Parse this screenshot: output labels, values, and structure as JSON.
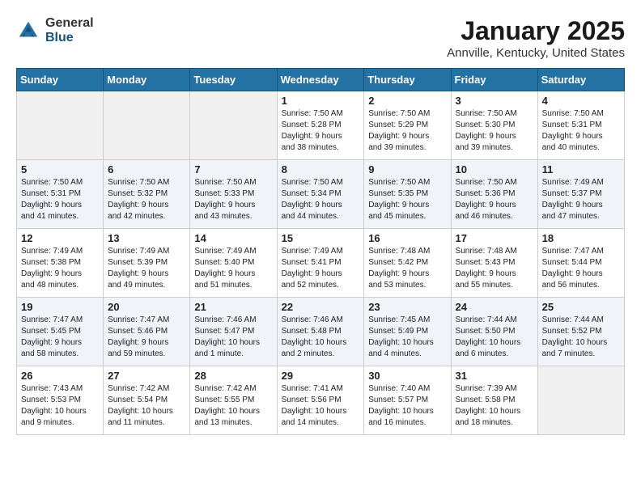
{
  "header": {
    "logo_general": "General",
    "logo_blue": "Blue",
    "month_title": "January 2025",
    "location": "Annville, Kentucky, United States"
  },
  "days_of_week": [
    "Sunday",
    "Monday",
    "Tuesday",
    "Wednesday",
    "Thursday",
    "Friday",
    "Saturday"
  ],
  "weeks": [
    [
      {
        "day": "",
        "info": ""
      },
      {
        "day": "",
        "info": ""
      },
      {
        "day": "",
        "info": ""
      },
      {
        "day": "1",
        "info": "Sunrise: 7:50 AM\nSunset: 5:28 PM\nDaylight: 9 hours\nand 38 minutes."
      },
      {
        "day": "2",
        "info": "Sunrise: 7:50 AM\nSunset: 5:29 PM\nDaylight: 9 hours\nand 39 minutes."
      },
      {
        "day": "3",
        "info": "Sunrise: 7:50 AM\nSunset: 5:30 PM\nDaylight: 9 hours\nand 39 minutes."
      },
      {
        "day": "4",
        "info": "Sunrise: 7:50 AM\nSunset: 5:31 PM\nDaylight: 9 hours\nand 40 minutes."
      }
    ],
    [
      {
        "day": "5",
        "info": "Sunrise: 7:50 AM\nSunset: 5:31 PM\nDaylight: 9 hours\nand 41 minutes."
      },
      {
        "day": "6",
        "info": "Sunrise: 7:50 AM\nSunset: 5:32 PM\nDaylight: 9 hours\nand 42 minutes."
      },
      {
        "day": "7",
        "info": "Sunrise: 7:50 AM\nSunset: 5:33 PM\nDaylight: 9 hours\nand 43 minutes."
      },
      {
        "day": "8",
        "info": "Sunrise: 7:50 AM\nSunset: 5:34 PM\nDaylight: 9 hours\nand 44 minutes."
      },
      {
        "day": "9",
        "info": "Sunrise: 7:50 AM\nSunset: 5:35 PM\nDaylight: 9 hours\nand 45 minutes."
      },
      {
        "day": "10",
        "info": "Sunrise: 7:50 AM\nSunset: 5:36 PM\nDaylight: 9 hours\nand 46 minutes."
      },
      {
        "day": "11",
        "info": "Sunrise: 7:49 AM\nSunset: 5:37 PM\nDaylight: 9 hours\nand 47 minutes."
      }
    ],
    [
      {
        "day": "12",
        "info": "Sunrise: 7:49 AM\nSunset: 5:38 PM\nDaylight: 9 hours\nand 48 minutes."
      },
      {
        "day": "13",
        "info": "Sunrise: 7:49 AM\nSunset: 5:39 PM\nDaylight: 9 hours\nand 49 minutes."
      },
      {
        "day": "14",
        "info": "Sunrise: 7:49 AM\nSunset: 5:40 PM\nDaylight: 9 hours\nand 51 minutes."
      },
      {
        "day": "15",
        "info": "Sunrise: 7:49 AM\nSunset: 5:41 PM\nDaylight: 9 hours\nand 52 minutes."
      },
      {
        "day": "16",
        "info": "Sunrise: 7:48 AM\nSunset: 5:42 PM\nDaylight: 9 hours\nand 53 minutes."
      },
      {
        "day": "17",
        "info": "Sunrise: 7:48 AM\nSunset: 5:43 PM\nDaylight: 9 hours\nand 55 minutes."
      },
      {
        "day": "18",
        "info": "Sunrise: 7:47 AM\nSunset: 5:44 PM\nDaylight: 9 hours\nand 56 minutes."
      }
    ],
    [
      {
        "day": "19",
        "info": "Sunrise: 7:47 AM\nSunset: 5:45 PM\nDaylight: 9 hours\nand 58 minutes."
      },
      {
        "day": "20",
        "info": "Sunrise: 7:47 AM\nSunset: 5:46 PM\nDaylight: 9 hours\nand 59 minutes."
      },
      {
        "day": "21",
        "info": "Sunrise: 7:46 AM\nSunset: 5:47 PM\nDaylight: 10 hours\nand 1 minute."
      },
      {
        "day": "22",
        "info": "Sunrise: 7:46 AM\nSunset: 5:48 PM\nDaylight: 10 hours\nand 2 minutes."
      },
      {
        "day": "23",
        "info": "Sunrise: 7:45 AM\nSunset: 5:49 PM\nDaylight: 10 hours\nand 4 minutes."
      },
      {
        "day": "24",
        "info": "Sunrise: 7:44 AM\nSunset: 5:50 PM\nDaylight: 10 hours\nand 6 minutes."
      },
      {
        "day": "25",
        "info": "Sunrise: 7:44 AM\nSunset: 5:52 PM\nDaylight: 10 hours\nand 7 minutes."
      }
    ],
    [
      {
        "day": "26",
        "info": "Sunrise: 7:43 AM\nSunset: 5:53 PM\nDaylight: 10 hours\nand 9 minutes."
      },
      {
        "day": "27",
        "info": "Sunrise: 7:42 AM\nSunset: 5:54 PM\nDaylight: 10 hours\nand 11 minutes."
      },
      {
        "day": "28",
        "info": "Sunrise: 7:42 AM\nSunset: 5:55 PM\nDaylight: 10 hours\nand 13 minutes."
      },
      {
        "day": "29",
        "info": "Sunrise: 7:41 AM\nSunset: 5:56 PM\nDaylight: 10 hours\nand 14 minutes."
      },
      {
        "day": "30",
        "info": "Sunrise: 7:40 AM\nSunset: 5:57 PM\nDaylight: 10 hours\nand 16 minutes."
      },
      {
        "day": "31",
        "info": "Sunrise: 7:39 AM\nSunset: 5:58 PM\nDaylight: 10 hours\nand 18 minutes."
      },
      {
        "day": "",
        "info": ""
      }
    ]
  ]
}
